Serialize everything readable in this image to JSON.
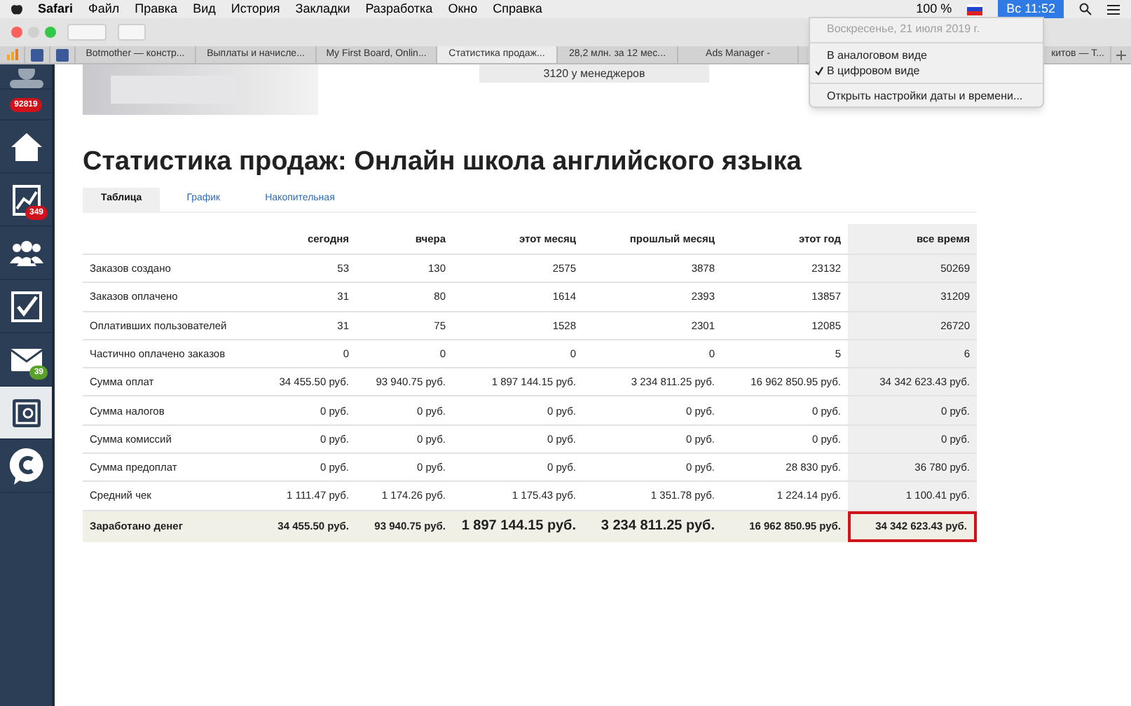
{
  "menu_bar": {
    "app": "Safari",
    "items": [
      "Файл",
      "Правка",
      "Вид",
      "История",
      "Закладки",
      "Разработка",
      "Окно",
      "Справка"
    ],
    "battery": "100 %",
    "clock": "Вс 11:52"
  },
  "clock_menu": {
    "items": [
      {
        "kind": "header",
        "label": "Воскресенье, 21 июля 2019 г."
      },
      {
        "kind": "separator"
      },
      {
        "kind": "option",
        "label": "В аналоговом виде",
        "checked": false
      },
      {
        "kind": "option",
        "label": "В цифровом виде",
        "checked": true
      },
      {
        "kind": "separator"
      },
      {
        "kind": "option",
        "label": "Открыть настройки даты и времени...",
        "checked": false
      }
    ]
  },
  "browser_tabs": [
    {
      "kind": "pinned-bars",
      "selected": false
    },
    {
      "kind": "pinned-f",
      "selected": false
    },
    {
      "kind": "pinned-f",
      "selected": false
    },
    {
      "kind": "tab",
      "label": "Botmother — констр...",
      "selected": false
    },
    {
      "kind": "tab",
      "label": "Выплаты и начисле...",
      "selected": false
    },
    {
      "kind": "tab",
      "label": "My First Board, Onlin...",
      "selected": false
    },
    {
      "kind": "tab",
      "label": "Статистика продаж...",
      "selected": true
    },
    {
      "kind": "tab",
      "label": "28,2 млн. за 12 мес...",
      "selected": false
    },
    {
      "kind": "tab",
      "label": "Ads Manager -",
      "selected": false
    },
    {
      "kind": "partial",
      "label": "китов — Т...",
      "selected": false
    }
  ],
  "sidebar": {
    "items": [
      {
        "kind": "avatar",
        "selected": false
      },
      {
        "kind": "badge-only",
        "badge": "92819",
        "selected": false
      },
      {
        "kind": "home",
        "selected": false
      },
      {
        "kind": "chart",
        "badge": "349",
        "selected": false
      },
      {
        "kind": "people",
        "selected": false
      },
      {
        "kind": "tasks",
        "selected": false
      },
      {
        "kind": "mail",
        "badge": "39",
        "selected": false
      },
      {
        "kind": "safe",
        "selected": true
      },
      {
        "kind": "logo",
        "selected": false
      }
    ]
  },
  "top_strip": {
    "managers": "3120 у менеджеров"
  },
  "title": "Статистика продаж: Онлайн школа английского языка",
  "view_tabs": [
    {
      "label": "Таблица",
      "selected": true
    },
    {
      "label": "График",
      "selected": false
    },
    {
      "label": "Накопительная",
      "selected": false
    }
  ],
  "table": {
    "columns": [
      "сегодня",
      "вчера",
      "этот месяц",
      "прошлый месяц",
      "этот год",
      "все время"
    ],
    "rows": [
      {
        "label": "Заказов создано",
        "cells": [
          "53",
          "130",
          "2575",
          "3878",
          "23132",
          "50269"
        ]
      },
      {
        "label": "Заказов оплачено",
        "cells": [
          "31",
          "80",
          "1614",
          "2393",
          "13857",
          "31209"
        ]
      },
      {
        "label": "Оплативших пользователей",
        "cells": [
          "31",
          "75",
          "1528",
          "2301",
          "12085",
          "26720"
        ]
      },
      {
        "label": "Частично оплачено заказов",
        "cells": [
          "0",
          "0",
          "0",
          "0",
          "5",
          "6"
        ]
      },
      {
        "label": "Сумма оплат",
        "cells": [
          "34 455.50 руб.",
          "93 940.75 руб.",
          "1 897 144.15 руб.",
          "3 234 811.25 руб.",
          "16 962 850.95 руб.",
          "34 342 623.43 руб."
        ]
      },
      {
        "label": "Сумма налогов",
        "cells": [
          "0 руб.",
          "0 руб.",
          "0 руб.",
          "0 руб.",
          "0 руб.",
          "0 руб."
        ]
      },
      {
        "label": "Сумма комиссий",
        "cells": [
          "0 руб.",
          "0 руб.",
          "0 руб.",
          "0 руб.",
          "0 руб.",
          "0 руб."
        ]
      },
      {
        "label": "Сумма предоплат",
        "cells": [
          "0 руб.",
          "0 руб.",
          "0 руб.",
          "0 руб.",
          "28 830 руб.",
          "36 780 руб."
        ]
      },
      {
        "label": "Средний чек",
        "cells": [
          "1 111.47 руб.",
          "1 174.26 руб.",
          "1 175.43 руб.",
          "1 351.78 руб.",
          "1 224.14 руб.",
          "1 100.41 руб."
        ]
      }
    ],
    "total": {
      "label": "Заработано денег",
      "cells": [
        {
          "value": "34 455.50 руб.",
          "large": false,
          "highlighted": false
        },
        {
          "value": "93 940.75 руб.",
          "large": false,
          "highlighted": false
        },
        {
          "value": "1 897 144.15 руб.",
          "large": true,
          "highlighted": false
        },
        {
          "value": "3 234 811.25 руб.",
          "large": true,
          "highlighted": false
        },
        {
          "value": "16 962 850.95 руб.",
          "large": false,
          "highlighted": false
        },
        {
          "value": "34 342 623.43 руб.",
          "large": false,
          "highlighted": true
        }
      ]
    }
  }
}
